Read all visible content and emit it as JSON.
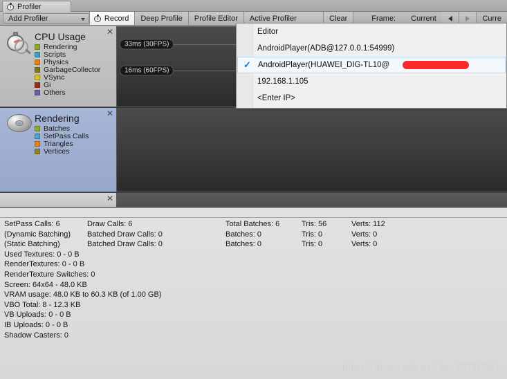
{
  "window": {
    "tab_label": "Profiler",
    "tab_icon": "stopwatch-icon"
  },
  "toolbar": {
    "add_profiler": "Add Profiler",
    "record": "Record",
    "record_icon": "stopwatch-icon",
    "deep_profile": "Deep Profile",
    "profile_editor": "Profile Editor",
    "active_profiler": "Active Profiler",
    "clear": "Clear",
    "frame_label": "Frame:",
    "frame_value": "Current",
    "prev_icon": "triangle-left-icon",
    "next_icon": "triangle-right-icon",
    "current_truncated": "Curre"
  },
  "active_profiler_menu": {
    "items": [
      {
        "label": "Editor",
        "checked": false,
        "redacted": false
      },
      {
        "label": "AndroidPlayer(ADB@127.0.0.1:54999)",
        "checked": false,
        "redacted": false
      },
      {
        "label": "AndroidPlayer(HUAWEI_DIG-TL10@",
        "checked": true,
        "redacted": true
      },
      {
        "label": "192.168.1.105",
        "checked": false,
        "redacted": false
      },
      {
        "label": "<Enter IP>",
        "checked": false,
        "redacted": false
      }
    ],
    "check_glyph": "✓",
    "redaction_color": "#fb2b2b"
  },
  "panels": [
    {
      "title": "CPU Usage",
      "icon": "stopwatch-magnifier-icon",
      "selected": false,
      "close_icon": "close-icon",
      "legend": [
        {
          "label": "Rendering",
          "color": "#8fa92b"
        },
        {
          "label": "Scripts",
          "color": "#3f9ec4"
        },
        {
          "label": "Physics",
          "color": "#e8801a"
        },
        {
          "label": "GarbageCollector",
          "color": "#7d7a1c"
        },
        {
          "label": "VSync",
          "color": "#d9c21f"
        },
        {
          "label": "Gi",
          "color": "#9e2a18"
        },
        {
          "label": "Others",
          "color": "#6e5fa8"
        }
      ]
    },
    {
      "title": "Rendering",
      "icon": "torus-icon",
      "selected": true,
      "close_icon": "close-icon",
      "legend": [
        {
          "label": "Batches",
          "color": "#8fa92b"
        },
        {
          "label": "SetPass Calls",
          "color": "#4fa5c4"
        },
        {
          "label": "Triangles",
          "color": "#e8801a"
        },
        {
          "label": "Vertices",
          "color": "#8d862a"
        }
      ]
    }
  ],
  "graph": {
    "fps_markers": [
      {
        "label": "33ms (30FPS)"
      },
      {
        "label": "16ms (60FPS)"
      }
    ]
  },
  "stats": {
    "table": [
      {
        "col1": "SetPass Calls: 6",
        "col2": "Draw Calls: 6",
        "col3": "Total Batches: 6",
        "col4": "Tris: 56",
        "col5": "Verts: 112"
      },
      {
        "col1": "(Dynamic Batching)",
        "col2": "Batched Draw Calls: 0",
        "col3": "Batches: 0",
        "col4": "Tris: 0",
        "col5": "Verts: 0"
      },
      {
        "col1": "(Static Batching)",
        "col2": "Batched Draw Calls: 0",
        "col3": "Batches: 0",
        "col4": "Tris: 0",
        "col5": "Verts: 0"
      }
    ],
    "lines": [
      "Used Textures: 0 - 0 B",
      "RenderTextures: 0 - 0 B",
      "RenderTexture Switches: 0",
      "Screen: 64x64 - 48.0 KB",
      "VRAM usage: 48.0 KB to 60.3 KB (of 1.00 GB)",
      "VBO Total: 8 - 12.3 KB",
      "VB Uploads: 0 - 0 B",
      "IB Uploads: 0 - 0 B",
      "Shadow Casters: 0"
    ]
  },
  "watermark": "https://blog.csdn.net/qq_39710961"
}
